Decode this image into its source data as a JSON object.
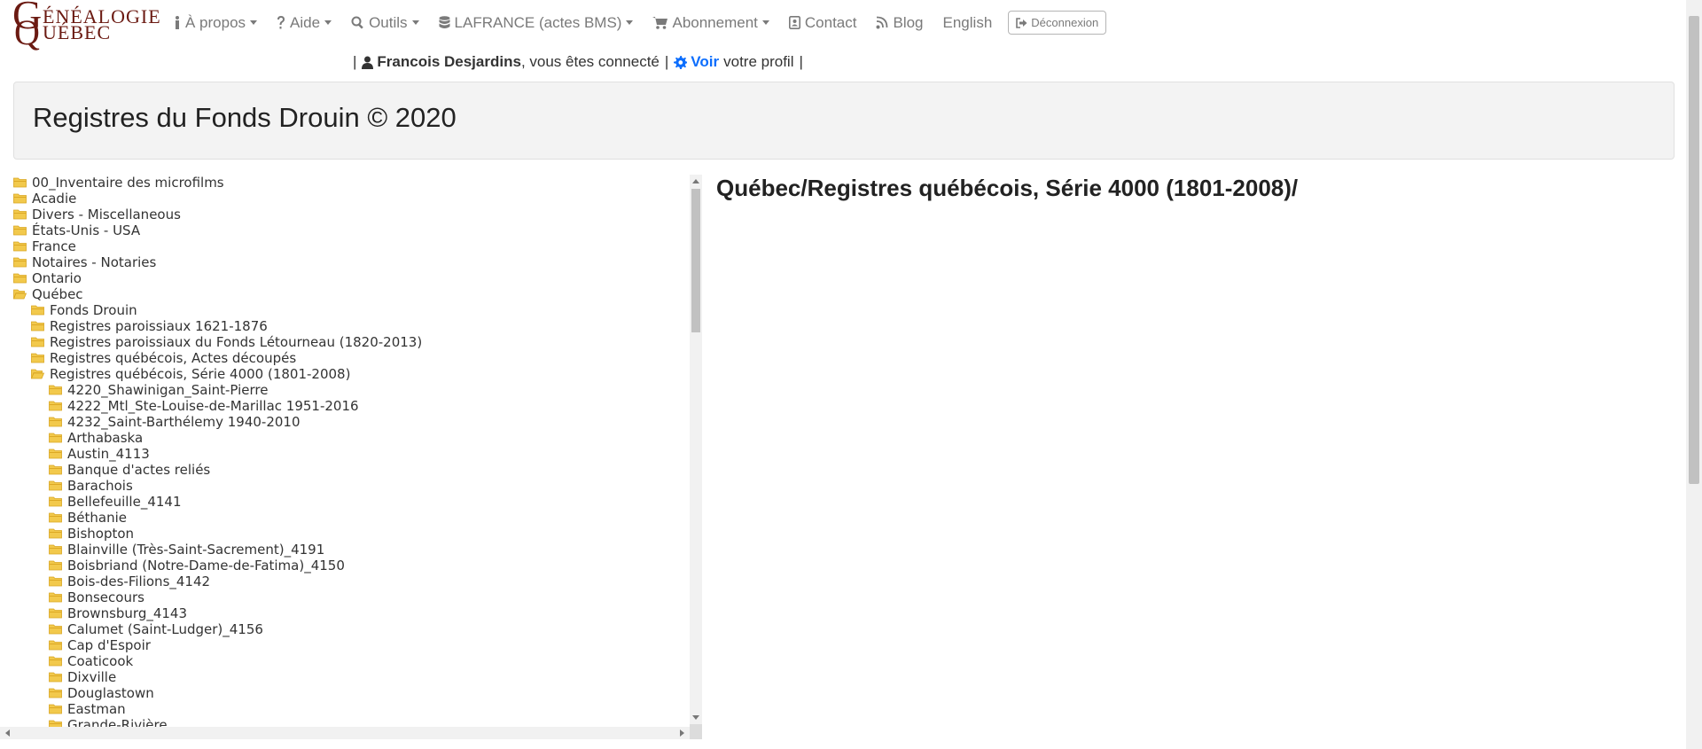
{
  "logo": {
    "text_line1": "G",
    "text_small1": "ÉNÉALOGIE",
    "text_line2": "Q",
    "text_small2": "UÉBEC"
  },
  "nav": [
    {
      "label": "À propos",
      "icon": "info-icon",
      "dropdown": true
    },
    {
      "label": "Aide",
      "icon": "question-icon",
      "dropdown": true
    },
    {
      "label": "Outils",
      "icon": "search-icon",
      "dropdown": true
    },
    {
      "label": "LAFRANCE (actes BMS)",
      "icon": "database-icon",
      "dropdown": true
    },
    {
      "label": "Abonnement",
      "icon": "cart-icon",
      "dropdown": true
    },
    {
      "label": "Contact",
      "icon": "contact-icon",
      "dropdown": false
    },
    {
      "label": "Blog",
      "icon": "rss-icon",
      "dropdown": false
    },
    {
      "label": "English",
      "icon": "",
      "dropdown": false
    }
  ],
  "logout_label": "Déconnexion",
  "userbar": {
    "sep": "|",
    "user_name": "Francois Desjardins",
    "connected_text": ", vous êtes connecté",
    "view_link": "Voir",
    "profile_text": "votre profil"
  },
  "page_title": "Registres du Fonds Drouin © 2020",
  "current_path": "Québec/Registres québécois, Série 4000 (1801-2008)/",
  "tree": [
    {
      "label": "00_Inventaire des microfilms",
      "level": 0,
      "open": false
    },
    {
      "label": "Acadie",
      "level": 0,
      "open": false
    },
    {
      "label": "Divers - Miscellaneous",
      "level": 0,
      "open": false
    },
    {
      "label": "États-Unis - USA",
      "level": 0,
      "open": false
    },
    {
      "label": "France",
      "level": 0,
      "open": false
    },
    {
      "label": "Notaires - Notaries",
      "level": 0,
      "open": false
    },
    {
      "label": "Ontario",
      "level": 0,
      "open": false
    },
    {
      "label": "Québec",
      "level": 0,
      "open": true
    },
    {
      "label": "Fonds Drouin",
      "level": 1,
      "open": false
    },
    {
      "label": "Registres paroissiaux 1621-1876",
      "level": 1,
      "open": false
    },
    {
      "label": "Registres paroissiaux du Fonds Létourneau (1820-2013)",
      "level": 1,
      "open": false
    },
    {
      "label": "Registres québécois, Actes découpés",
      "level": 1,
      "open": false
    },
    {
      "label": "Registres québécois, Série 4000 (1801-2008)",
      "level": 1,
      "open": true
    },
    {
      "label": "4220_Shawinigan_Saint-Pierre",
      "level": 2,
      "open": false
    },
    {
      "label": "4222_Mtl_Ste-Louise-de-Marillac 1951-2016",
      "level": 2,
      "open": false
    },
    {
      "label": "4232_Saint-Barthélemy 1940-2010",
      "level": 2,
      "open": false
    },
    {
      "label": "Arthabaska",
      "level": 2,
      "open": false
    },
    {
      "label": "Austin_4113",
      "level": 2,
      "open": false
    },
    {
      "label": "Banque d'actes reliés",
      "level": 2,
      "open": false
    },
    {
      "label": "Barachois",
      "level": 2,
      "open": false
    },
    {
      "label": "Bellefeuille_4141",
      "level": 2,
      "open": false
    },
    {
      "label": "Béthanie",
      "level": 2,
      "open": false
    },
    {
      "label": "Bishopton",
      "level": 2,
      "open": false
    },
    {
      "label": "Blainville (Très-Saint-Sacrement)_4191",
      "level": 2,
      "open": false
    },
    {
      "label": "Boisbriand (Notre-Dame-de-Fatima)_4150",
      "level": 2,
      "open": false
    },
    {
      "label": "Bois-des-Filions_4142",
      "level": 2,
      "open": false
    },
    {
      "label": "Bonsecours",
      "level": 2,
      "open": false
    },
    {
      "label": "Brownsburg_4143",
      "level": 2,
      "open": false
    },
    {
      "label": "Calumet (Saint-Ludger)_4156",
      "level": 2,
      "open": false
    },
    {
      "label": "Cap d'Espoir",
      "level": 2,
      "open": false
    },
    {
      "label": "Coaticook",
      "level": 2,
      "open": false
    },
    {
      "label": "Dixville",
      "level": 2,
      "open": false
    },
    {
      "label": "Douglastown",
      "level": 2,
      "open": false
    },
    {
      "label": "Eastman",
      "level": 2,
      "open": false
    },
    {
      "label": "Grande-Rivière",
      "level": 2,
      "open": false
    }
  ],
  "colors": {
    "folder": "#f2c94c",
    "folder_dark": "#d9a520",
    "link": "#0d6efd",
    "logo": "#6b1a12"
  }
}
